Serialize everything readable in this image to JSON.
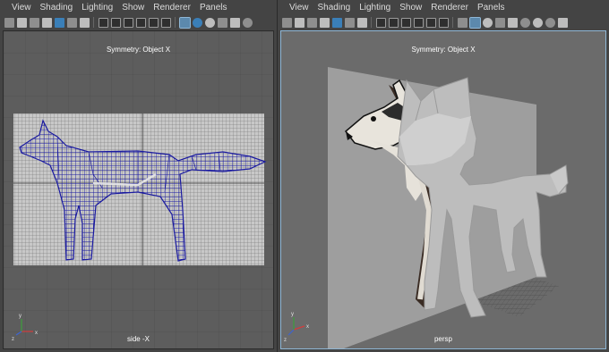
{
  "left_panel": {
    "menu": [
      "View",
      "Shading",
      "Lighting",
      "Show",
      "Renderer",
      "Panels"
    ],
    "symmetry_label": "Symmetry: Object X",
    "camera_label": "side -X"
  },
  "right_panel": {
    "menu": [
      "View",
      "Shading",
      "Lighting",
      "Show",
      "Renderer",
      "Panels"
    ],
    "symmetry_label": "Symmetry: Object X",
    "camera_label": "persp"
  },
  "axis": {
    "x": "x",
    "y": "y",
    "z": "z"
  },
  "icons": [
    "camera-icon",
    "select-camera-icon",
    "bookmark-icon",
    "image-plane-icon",
    "grid-icon",
    "film-gate-icon",
    "wireframe-icon",
    "smooth-shade-icon",
    "textured-icon",
    "lights-icon",
    "shadows-icon",
    "isolate-icon",
    "xray-icon"
  ],
  "colors": {
    "wireframe": "#1a1aa0",
    "selection_highlight": "#5c89ad",
    "panel_bg": "#444444",
    "viewport_side_bg": "#5d5d5d",
    "viewport_persp_bg": "#6b6b6b"
  }
}
